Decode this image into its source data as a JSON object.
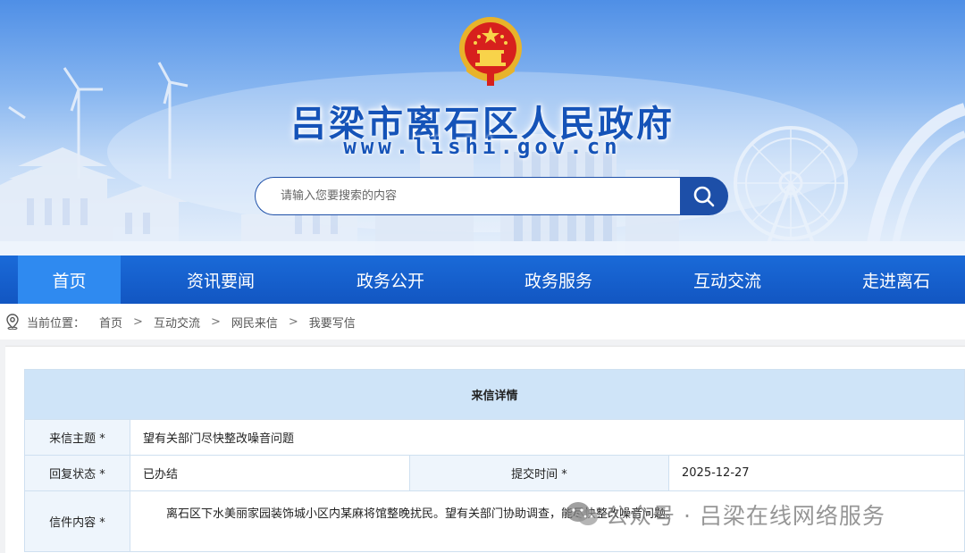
{
  "header": {
    "site_title": "吕梁市离石区人民政府",
    "site_url": "www.lishi.gov.cn",
    "search_placeholder": "请输入您要搜索的内容",
    "colors": {
      "brand_blue": "#1553b8",
      "nav_blue": "#1256c2",
      "nav_active": "#2f8af0"
    }
  },
  "nav": {
    "items": [
      {
        "label": "首页",
        "active": true
      },
      {
        "label": "资讯要闻"
      },
      {
        "label": "政务公开"
      },
      {
        "label": "政务服务"
      },
      {
        "label": "互动交流"
      },
      {
        "label": "走进离石"
      }
    ]
  },
  "breadcrumb": {
    "label": "当前位置：",
    "items": [
      "首页",
      "互动交流",
      "网民来信",
      "我要写信"
    ],
    "separator": ">"
  },
  "detail": {
    "heading": "来信详情",
    "subject_label": "来信主题 *",
    "subject_value": "望有关部门尽快整改噪音问题",
    "status_label": "回复状态 *",
    "status_value": "已办结",
    "submit_label": "提交时间 *",
    "submit_value": "2025-12-27",
    "content_label": "信件内容 *",
    "content_value": "离石区下水美丽家园装饰城小区内某麻将馆整晚扰民。望有关部门协助调查，能尽快整改噪音问题。"
  },
  "watermark": {
    "text": "公众号 · 吕梁在线网络服务"
  }
}
